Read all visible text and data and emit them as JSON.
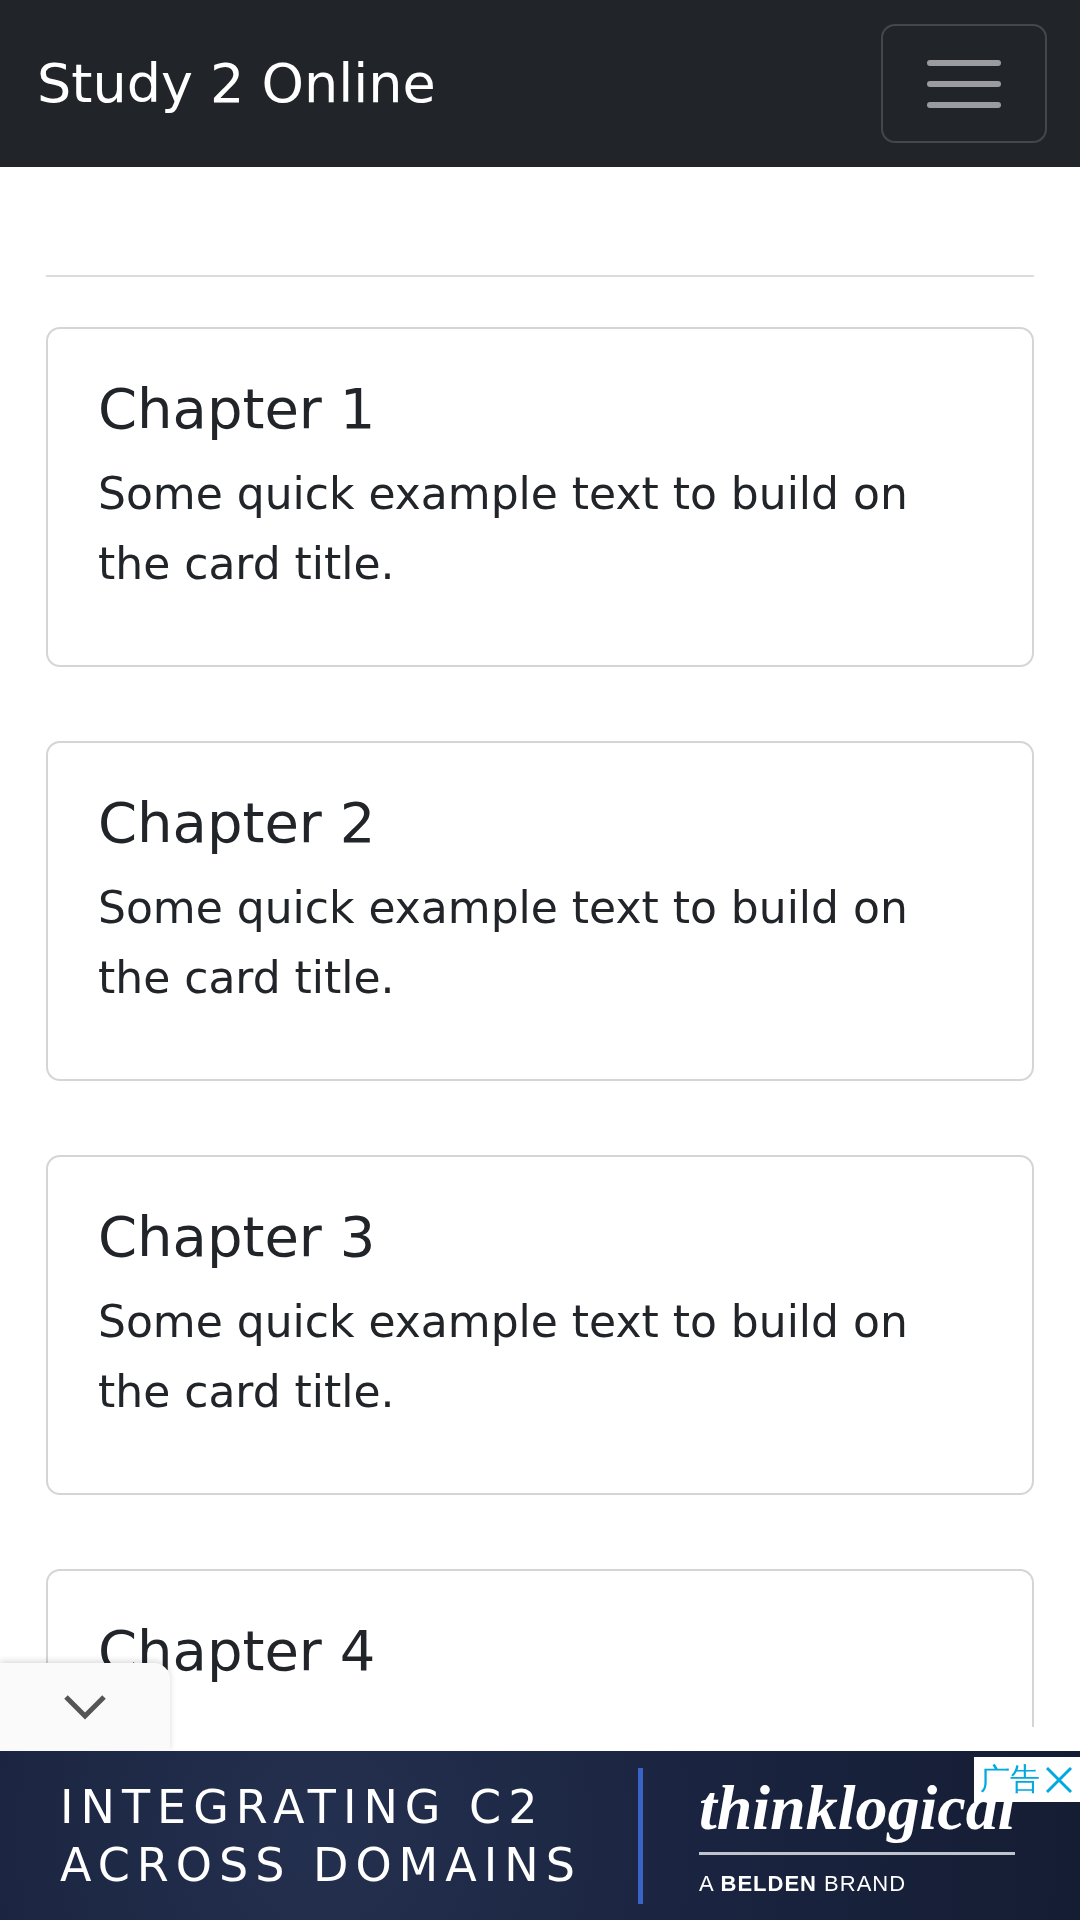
{
  "navbar": {
    "brand": "Study 2 Online",
    "menu_button": {
      "expanded": false
    }
  },
  "cards": [
    {
      "title": "Chapter 1",
      "text": "Some quick example text to build on the card title."
    },
    {
      "title": "Chapter 2",
      "text": "Some quick example text to build on the card title."
    },
    {
      "title": "Chapter 3",
      "text": "Some quick example text to build on the card title."
    },
    {
      "title": "Chapter 4"
    }
  ],
  "ad": {
    "headline": [
      "INTEGRATING C2",
      "ACROSS DOMAINS"
    ],
    "logo": "thinklogical",
    "tagline": "A **BELDEN** BRAND",
    "badge": "广告",
    "collapsed": false
  }
}
